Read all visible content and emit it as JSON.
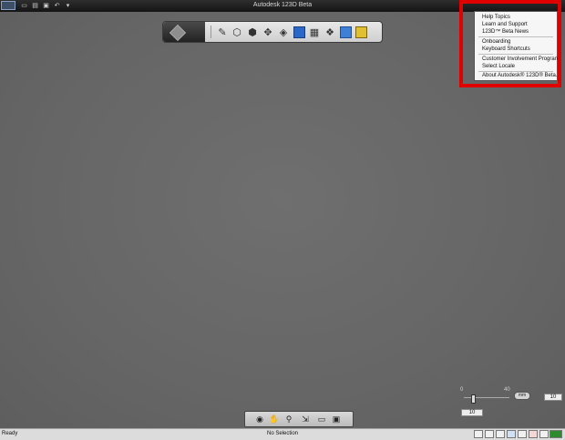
{
  "window": {
    "title": "Autodesk 123D Beta"
  },
  "menu": {
    "items": [
      "Help Topics",
      "Learn and Support",
      "123D™ Beta News",
      "Onboarding",
      "Keyboard Shortcuts",
      "Customer Involvement Program",
      "Select Locale",
      "About Autodesk® 123D® Beta..."
    ]
  },
  "grid": {
    "label_min": "0",
    "label_max": "40",
    "unit": "mm",
    "spacing_value": "10",
    "size_value": "10"
  },
  "status": {
    "left": "Ready",
    "center": "No Selection"
  },
  "colors": {
    "highlight": "#e00000",
    "menu_bg": "#f6f6f6"
  }
}
